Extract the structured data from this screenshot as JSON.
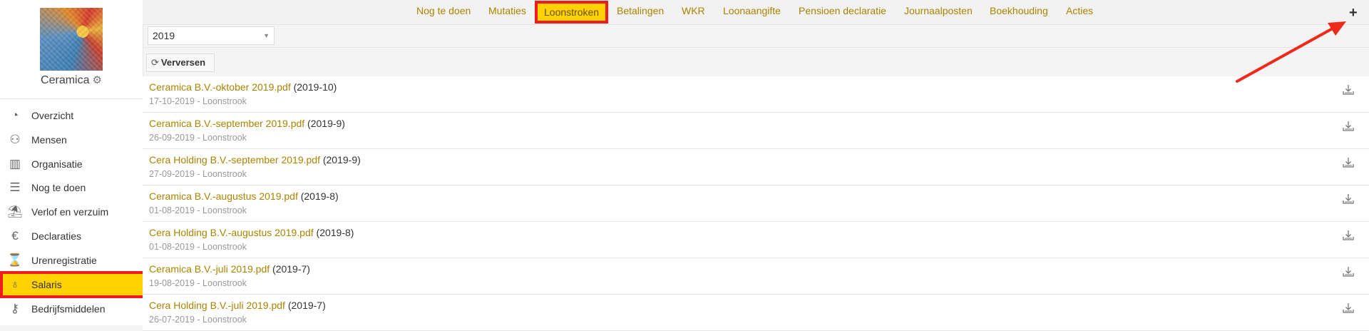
{
  "sidebar": {
    "company_name": "Ceramica",
    "items": [
      {
        "label": "Overzicht",
        "icon": "pie-chart-icon",
        "glyph": "◔",
        "active": false
      },
      {
        "label": "Mensen",
        "icon": "people-icon",
        "glyph": "⚇",
        "active": false
      },
      {
        "label": "Organisatie",
        "icon": "building-icon",
        "glyph": "▥",
        "active": false
      },
      {
        "label": "Nog te doen",
        "icon": "checklist-icon",
        "glyph": "☰",
        "active": false
      },
      {
        "label": "Verlof en verzuim",
        "icon": "beach-icon",
        "glyph": "⛱",
        "active": false
      },
      {
        "label": "Declaraties",
        "icon": "euro-icon",
        "glyph": "€",
        "active": false
      },
      {
        "label": "Urenregistratie",
        "icon": "hourglass-icon",
        "glyph": "⌛",
        "active": false
      },
      {
        "label": "Salaris",
        "icon": "money-bag-icon",
        "glyph": "♁",
        "active": true
      },
      {
        "label": "Bedrijfsmiddelen",
        "icon": "key-icon",
        "glyph": "⚷",
        "active": false
      }
    ]
  },
  "tabs": [
    {
      "label": "Nog te doen",
      "active": false
    },
    {
      "label": "Mutaties",
      "active": false
    },
    {
      "label": "Loonstroken",
      "active": true
    },
    {
      "label": "Betalingen",
      "active": false
    },
    {
      "label": "WKR",
      "active": false
    },
    {
      "label": "Loonaangifte",
      "active": false
    },
    {
      "label": "Pensioen declaratie",
      "active": false
    },
    {
      "label": "Journaalposten",
      "active": false
    },
    {
      "label": "Boekhouding",
      "active": false
    },
    {
      "label": "Acties",
      "active": false
    }
  ],
  "add_label": "+",
  "year_select": {
    "value": "2019"
  },
  "refresh_label": "Verversen",
  "payslips": [
    {
      "file": "Ceramica B.V.-oktober 2019.pdf",
      "period": "(2019-10)",
      "meta": "17-10-2019 - Loonstrook"
    },
    {
      "file": "Ceramica B.V.-september 2019.pdf",
      "period": "(2019-9)",
      "meta": "26-09-2019 - Loonstrook"
    },
    {
      "file": "Cera Holding B.V.-september 2019.pdf",
      "period": "(2019-9)",
      "meta": "27-09-2019 - Loonstrook"
    },
    {
      "file": "Ceramica B.V.-augustus 2019.pdf",
      "period": "(2019-8)",
      "meta": "01-08-2019 - Loonstrook"
    },
    {
      "file": "Cera Holding B.V.-augustus 2019.pdf",
      "period": "(2019-8)",
      "meta": "01-08-2019 - Loonstrook"
    },
    {
      "file": "Ceramica B.V.-juli 2019.pdf",
      "period": "(2019-7)",
      "meta": "19-08-2019 - Loonstrook"
    },
    {
      "file": "Cera Holding B.V.-juli 2019.pdf",
      "period": "(2019-7)",
      "meta": "26-07-2019 - Loonstrook"
    }
  ],
  "colors": {
    "accent": "#ffd200",
    "highlight": "#ee1c1c",
    "link": "#a98300"
  }
}
